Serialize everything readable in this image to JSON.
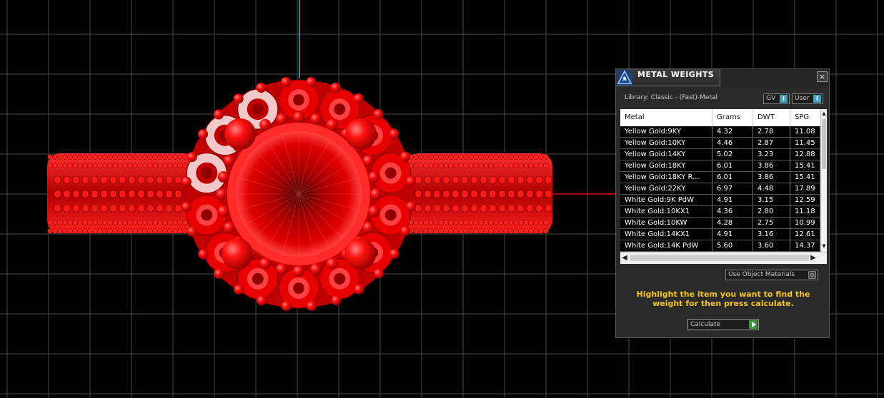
{
  "window": {
    "title": "METAL WEIGHTS",
    "close_label": "×"
  },
  "library_label": "Library: Classic - (Fast)-Metal",
  "toggles": {
    "gv": {
      "label": "GV",
      "knob": "I"
    },
    "user": {
      "label": "User",
      "knob": "I"
    }
  },
  "table": {
    "columns": [
      "Metal",
      "Grams",
      "DWT",
      "SPG"
    ],
    "rows": [
      [
        "Yellow Gold:9KY",
        "4.32",
        "2.78",
        "11.08"
      ],
      [
        "Yellow Gold:10KY",
        "4.46",
        "2.87",
        "11.45"
      ],
      [
        "Yellow Gold:14KY",
        "5.02",
        "3.23",
        "12.88"
      ],
      [
        "Yellow Gold:18KY",
        "6.01",
        "3.86",
        "15.41"
      ],
      [
        "Yellow Gold:18KY R...",
        "6.01",
        "3.86",
        "15.41"
      ],
      [
        "Yellow Gold:22KY",
        "6.97",
        "4.48",
        "17.89"
      ],
      [
        "White Gold:9K PdW",
        "4.91",
        "3.15",
        "12.59"
      ],
      [
        "White Gold:10KX1",
        "4.36",
        "2.80",
        "11.18"
      ],
      [
        "White Gold:10KW",
        "4.28",
        "2.75",
        "10.99"
      ],
      [
        "White Gold:14KX1",
        "4.91",
        "3.16",
        "12.61"
      ],
      [
        "White Gold:14K PdW",
        "5.60",
        "3.60",
        "14.37"
      ]
    ]
  },
  "use_object_materials_label": "Use Object Materials",
  "instructions": "Highlight the item you want to find the weight for then press calculate.",
  "calculate_label": "Calculate",
  "colors": {
    "viewport_bg": "#000000",
    "grid": "#4a4a4a",
    "model_red": "#e00000",
    "panel_bg": "#2a2a2a",
    "instruction_text": "#f5c518",
    "toggle_knob": "#3fa6c0",
    "calc_play": "#3a9a3a"
  }
}
